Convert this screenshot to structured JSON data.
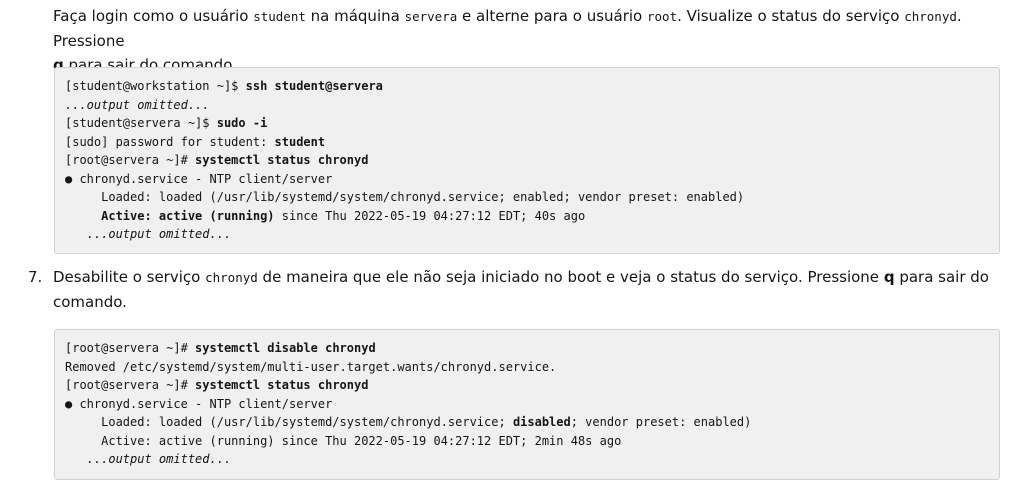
{
  "step6": {
    "t1": "Faça login como o usuário ",
    "c1": "student",
    "t2": " na máquina ",
    "c2": "servera",
    "t3": " e alterne para o usuário ",
    "c3": "root",
    "t4": ". Visualize o status do serviço ",
    "c4": "chronyd",
    "t5": ". Pressione",
    "key": "q",
    "t6": " para sair do comando."
  },
  "block1": {
    "l1_prompt": "[student@workstation ~]$ ",
    "l1_cmd": "ssh student@servera",
    "l2": "...output omitted...",
    "l3_prompt": "[student@servera ~]$ ",
    "l3_cmd": "sudo -i",
    "l4_text": "[sudo] password for student: ",
    "l4_input": "student",
    "l5_prompt": "[root@servera ~]# ",
    "l5_cmd": "systemctl status chronyd",
    "l6": "● chronyd.service - NTP client/server",
    "l7": "     Loaded: loaded (/usr/lib/systemd/system/chronyd.service; enabled; vendor preset: enabled)",
    "l8_indent": "     ",
    "l8_label": "Active: active (running)",
    "l8_rest": " since Thu 2022-05-19 04:27:12 EDT; 40s ago",
    "l9_indent": "   ",
    "l9": "...output omitted..."
  },
  "step7": {
    "number": "7.",
    "t1": "Desabilite o serviço ",
    "c1": "chronyd",
    "t2": " de maneira que ele não seja iniciado no boot e veja o status do serviço. Pressione ",
    "key": "q",
    "t3": " para sair do comando."
  },
  "block2": {
    "l1_prompt": "[root@servera ~]# ",
    "l1_cmd": "systemctl disable chronyd",
    "l2": "Removed /etc/systemd/system/multi-user.target.wants/chronyd.service.",
    "l3_prompt": "[root@servera ~]# ",
    "l3_cmd": "systemctl status chronyd",
    "l4": "● chronyd.service - NTP client/server",
    "l5_a": "     Loaded: loaded (/usr/lib/systemd/system/chronyd.service; ",
    "l5_b": "disabled",
    "l5_c": "; vendor preset: enabled)",
    "l6": "     Active: active (running) since Thu 2022-05-19 04:27:12 EDT; 2min 48s ago",
    "l7_indent": "   ",
    "l7": "...output omitted..."
  }
}
